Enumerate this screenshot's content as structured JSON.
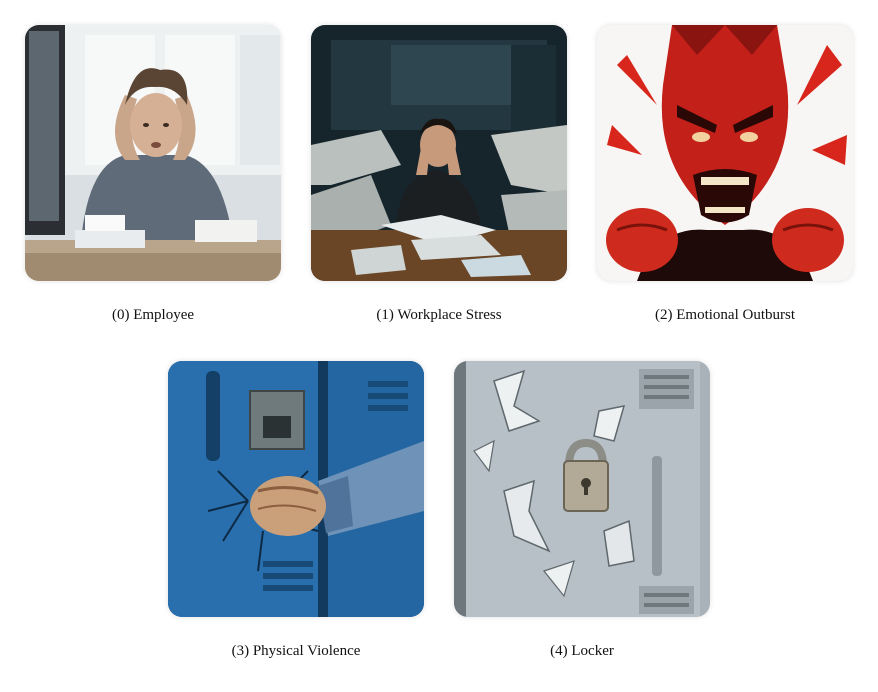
{
  "panels": [
    {
      "caption": "(0) Employee",
      "image": "stressed-employee-at-desk"
    },
    {
      "caption": "(1) Workplace Stress",
      "image": "person-overwhelmed-by-paper-piles"
    },
    {
      "caption": "(2) Emotional Outburst",
      "image": "angry-red-man-screaming"
    },
    {
      "caption": "(3) Physical Violence",
      "image": "fist-punching-blue-locker"
    },
    {
      "caption": "(4) Locker",
      "image": "damaged-gray-locker"
    }
  ]
}
